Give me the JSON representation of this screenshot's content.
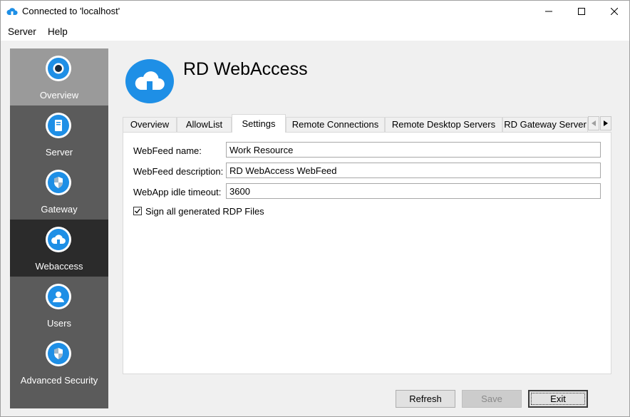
{
  "window": {
    "title": "Connected to 'localhost'"
  },
  "menu": {
    "items": [
      "Server",
      "Help"
    ]
  },
  "sidebar": {
    "items": [
      {
        "label": "Overview",
        "icon": "overview-icon"
      },
      {
        "label": "Server",
        "icon": "server-icon"
      },
      {
        "label": "Gateway",
        "icon": "shield-icon"
      },
      {
        "label": "Webaccess",
        "icon": "cloud-icon"
      },
      {
        "label": "Users",
        "icon": "users-icon"
      },
      {
        "label": "Advanced Security",
        "icon": "shield-icon"
      }
    ],
    "active": "Webaccess"
  },
  "header": {
    "title": "RD WebAccess",
    "icon": "cloud-icon"
  },
  "tabs": {
    "items": [
      "Overview",
      "AllowList",
      "Settings",
      "Remote Connections",
      "Remote Desktop Servers",
      "RD Gateway Server"
    ],
    "active": "Settings"
  },
  "settings": {
    "webfeed_name_label": "WebFeed name:",
    "webfeed_name_value": "Work Resource",
    "webfeed_desc_label": "WebFeed description:",
    "webfeed_desc_value": "RD WebAccess WebFeed",
    "idle_timeout_label": "WebApp idle timeout:",
    "idle_timeout_value": "3600",
    "sign_rdp_label": "Sign all generated RDP Files",
    "sign_rdp_checked": true
  },
  "buttons": {
    "refresh": "Refresh",
    "save": "Save",
    "exit": "Exit"
  },
  "colors": {
    "accent": "#1e8fe6",
    "sidebar_bg": "#5b5b5b",
    "sidebar_active": "#2b2b2b",
    "sidebar_overview": "#9a9a9a"
  }
}
